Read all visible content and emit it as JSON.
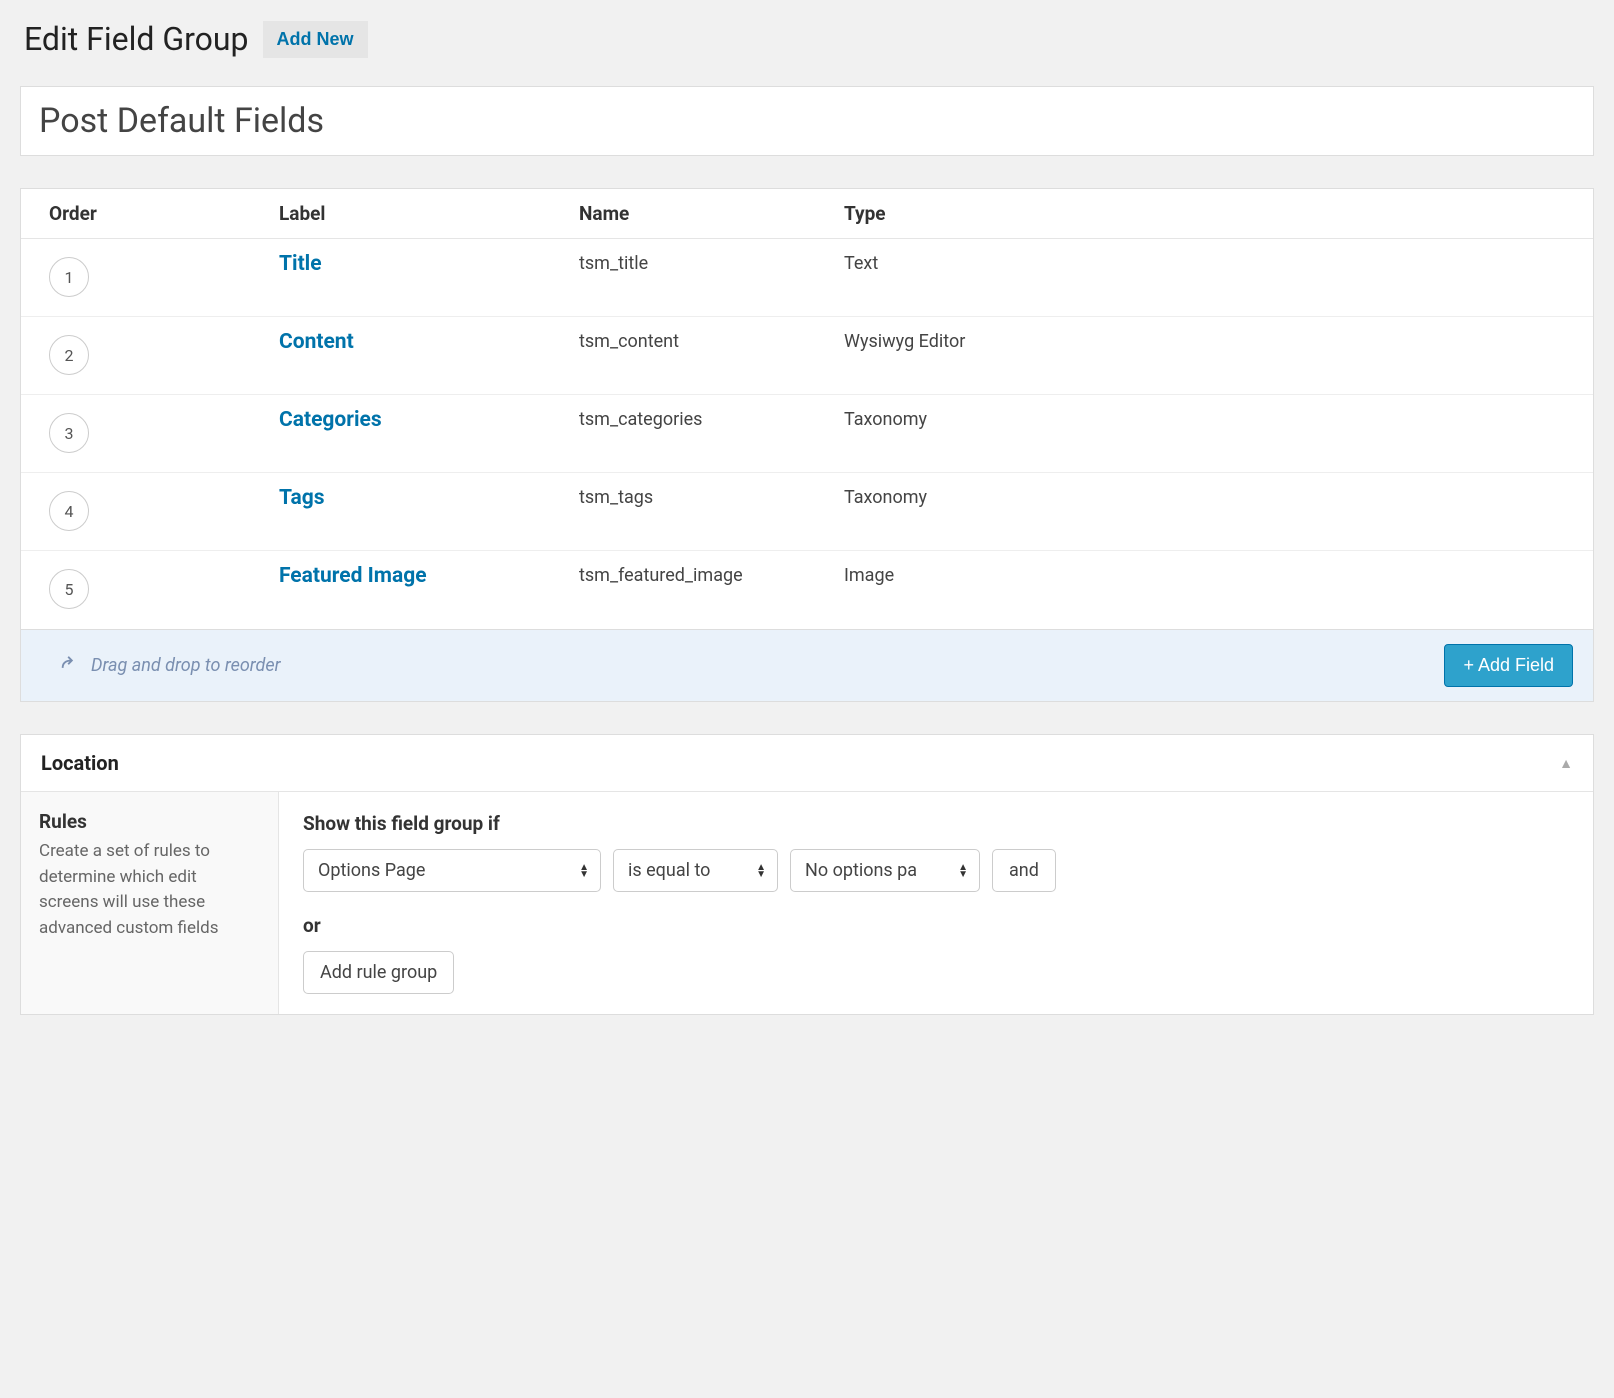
{
  "header": {
    "title": "Edit Field Group",
    "add_new": "Add New"
  },
  "field_group_title": "Post Default Fields",
  "columns": {
    "order": "Order",
    "label": "Label",
    "name": "Name",
    "type": "Type"
  },
  "fields": [
    {
      "order": "1",
      "label": "Title",
      "name": "tsm_title",
      "type": "Text"
    },
    {
      "order": "2",
      "label": "Content",
      "name": "tsm_content",
      "type": "Wysiwyg Editor"
    },
    {
      "order": "3",
      "label": "Categories",
      "name": "tsm_categories",
      "type": "Taxonomy"
    },
    {
      "order": "4",
      "label": "Tags",
      "name": "tsm_tags",
      "type": "Taxonomy"
    },
    {
      "order": "5",
      "label": "Featured Image",
      "name": "tsm_featured_image",
      "type": "Image"
    }
  ],
  "footer": {
    "drag_hint": "Drag and drop to reorder",
    "add_field": "+ Add Field"
  },
  "location": {
    "title": "Location",
    "sidebar_heading": "Rules",
    "sidebar_desc": "Create a set of rules to determine which edit screens will use these advanced custom fields",
    "show_if": "Show this field group if",
    "rule": {
      "param": "Options Page",
      "operator": "is equal to",
      "value": "No options pa",
      "and": "and"
    },
    "or": "or",
    "add_rule_group": "Add rule group"
  }
}
